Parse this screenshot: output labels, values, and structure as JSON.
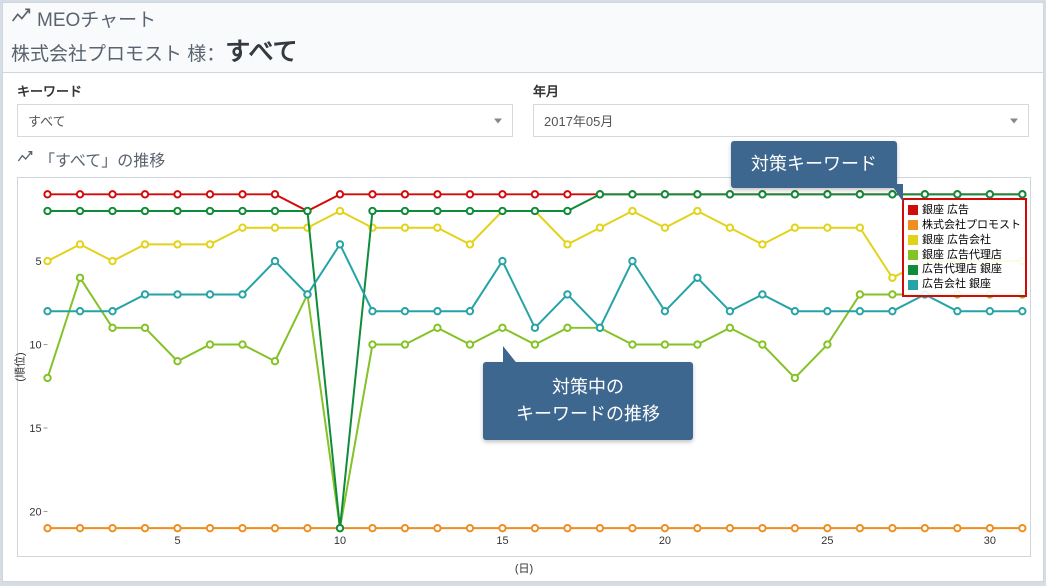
{
  "header": {
    "title": "MEOチャート",
    "company": "株式会社プロモスト 様：",
    "selection": "すべて"
  },
  "filters": {
    "keyword_label": "キーワード",
    "keyword_value": "すべて",
    "month_label": "年月",
    "month_value": "2017年05月"
  },
  "chart_title_prefix": "「すべて」の推移",
  "callouts": {
    "top": "対策キーワード",
    "mid_line1": "対策中の",
    "mid_line2": "キーワードの推移"
  },
  "legend": [
    {
      "color": "#d10a0a",
      "label": "銀座 広告"
    },
    {
      "color": "#ee8e1f",
      "label": "株式会社プロモスト"
    },
    {
      "color": "#e2d31a",
      "label": "銀座 広告会社"
    },
    {
      "color": "#84c225",
      "label": "銀座 広告代理店"
    },
    {
      "color": "#0f8c3a",
      "label": "広告代理店 銀座"
    },
    {
      "color": "#26a3a6",
      "label": "広告会社 銀座"
    }
  ],
  "axes": {
    "xlabel": "(日)",
    "ylabel": "(順位)",
    "x_ticks": [
      5,
      10,
      15,
      20,
      25,
      30
    ],
    "y_ticks": [
      5,
      10,
      15,
      20
    ]
  },
  "chart_data": {
    "type": "line",
    "title": "「すべて」の推移",
    "xlabel": "(日)",
    "ylabel": "(順位)",
    "xlim": [
      1,
      31
    ],
    "ylim": [
      21,
      0.5
    ],
    "note": "y軸は順位（小さいほど上位）。欠損値は点なし。",
    "x": [
      1,
      2,
      3,
      4,
      5,
      6,
      7,
      8,
      9,
      10,
      11,
      12,
      13,
      14,
      15,
      16,
      17,
      18,
      19,
      20,
      21,
      22,
      23,
      24,
      25,
      26,
      27,
      28,
      29,
      30,
      31
    ],
    "series": [
      {
        "name": "銀座 広告",
        "color": "#d10a0a",
        "values": [
          1,
          1,
          1,
          1,
          1,
          1,
          1,
          1,
          2,
          1,
          1,
          1,
          1,
          1,
          1,
          1,
          1,
          1,
          1,
          1,
          1,
          1,
          1,
          1,
          1,
          1,
          1,
          1,
          1,
          1,
          1
        ]
      },
      {
        "name": "株式会社プロモスト",
        "color": "#ee8e1f",
        "values": [
          21,
          21,
          21,
          21,
          21,
          21,
          21,
          21,
          21,
          21,
          21,
          21,
          21,
          21,
          21,
          21,
          21,
          21,
          21,
          21,
          21,
          21,
          21,
          21,
          21,
          21,
          21,
          21,
          21,
          21,
          21
        ]
      },
      {
        "name": "銀座 広告会社",
        "color": "#e2d31a",
        "values": [
          5,
          4,
          5,
          4,
          4,
          4,
          3,
          3,
          3,
          2,
          3,
          3,
          3,
          4,
          2,
          2,
          4,
          3,
          2,
          3,
          2,
          3,
          4,
          3,
          3,
          3,
          6,
          5,
          5,
          5,
          5
        ]
      },
      {
        "name": "銀座 広告代理店",
        "color": "#84c225",
        "values": [
          12,
          6,
          9,
          9,
          11,
          10,
          10,
          11,
          7,
          21,
          10,
          10,
          9,
          10,
          9,
          10,
          9,
          9,
          10,
          10,
          10,
          9,
          10,
          12,
          10,
          7,
          7,
          7,
          7,
          7,
          7
        ]
      },
      {
        "name": "広告代理店 銀座",
        "color": "#0f8c3a",
        "values": [
          2,
          2,
          2,
          2,
          2,
          2,
          2,
          2,
          2,
          21,
          2,
          2,
          2,
          2,
          2,
          2,
          2,
          1,
          1,
          1,
          1,
          1,
          1,
          1,
          1,
          1,
          1,
          1,
          1,
          1,
          1
        ]
      },
      {
        "name": "広告会社 銀座",
        "color": "#26a3a6",
        "values": [
          8,
          8,
          8,
          7,
          7,
          7,
          7,
          5,
          7,
          4,
          8,
          8,
          8,
          8,
          5,
          9,
          7,
          9,
          5,
          8,
          6,
          8,
          7,
          8,
          8,
          8,
          8,
          7,
          8,
          8,
          8
        ]
      }
    ]
  }
}
